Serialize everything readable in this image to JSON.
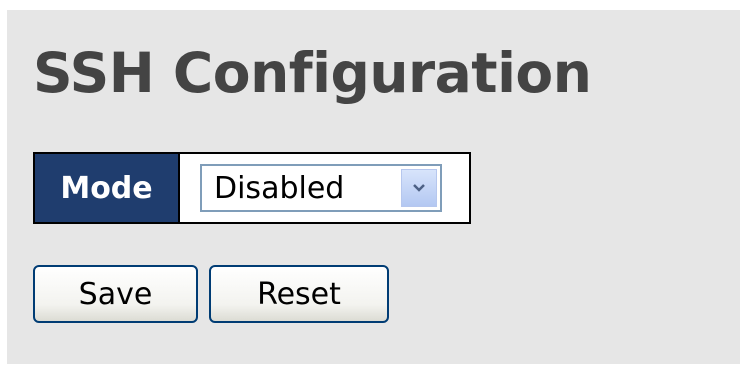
{
  "page": {
    "title": "SSH Configuration"
  },
  "form": {
    "mode_label": "Mode",
    "mode_value": "Disabled",
    "mode_options_visible": [
      "Disabled"
    ]
  },
  "buttons": {
    "save_label": "Save",
    "reset_label": "Reset"
  },
  "icons": {
    "dropdown": "chevron-down-icon"
  },
  "colors": {
    "background": "#e6e6e6",
    "title_text": "#444444",
    "label_header_bg": "#1f3d6e",
    "label_header_text": "#ffffff",
    "button_border": "#003c74",
    "select_border": "#7f9db9"
  }
}
